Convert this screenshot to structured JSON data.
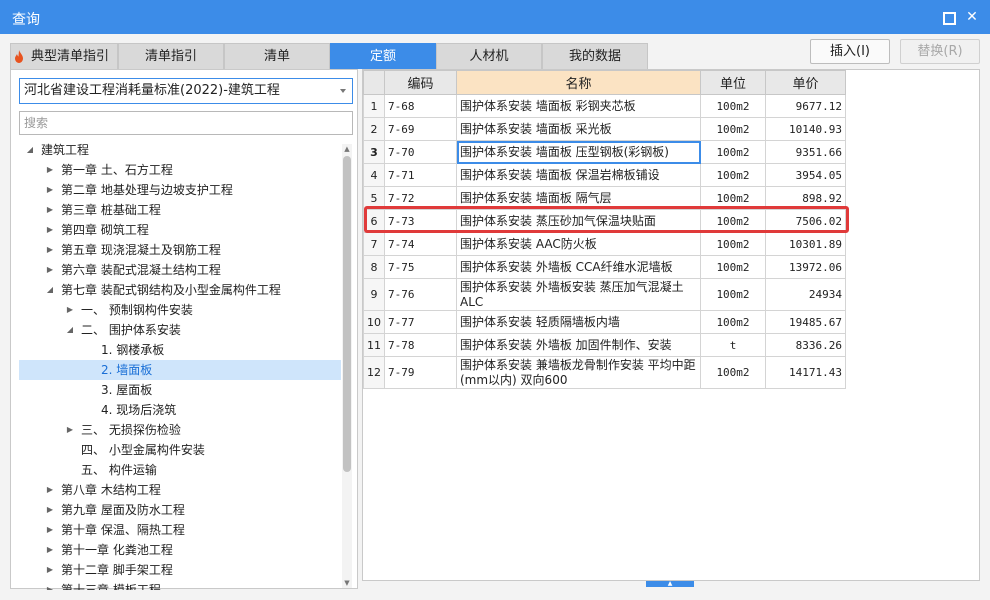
{
  "window": {
    "title": "查询",
    "maximize_glyph": "",
    "close_glyph": "✕"
  },
  "tabs": [
    {
      "label": "典型清单指引",
      "icon": "flame-icon"
    },
    {
      "label": "清单指引"
    },
    {
      "label": "清单"
    },
    {
      "label": "定额",
      "active": true
    },
    {
      "label": "人材机"
    },
    {
      "label": "我的数据"
    }
  ],
  "actions": {
    "insert_label": "插入(I)",
    "replace_label": "替换(R)"
  },
  "left": {
    "standard_selected": "河北省建设工程消耗量标准(2022)-建筑工程",
    "search_placeholder": "搜索",
    "tree": [
      {
        "label": "建筑工程",
        "state": "open",
        "level": 0
      },
      {
        "label": "第一章 土、石方工程",
        "state": "closed",
        "level": 1
      },
      {
        "label": "第二章 地基处理与边坡支护工程",
        "state": "closed",
        "level": 1
      },
      {
        "label": "第三章 桩基础工程",
        "state": "closed",
        "level": 1
      },
      {
        "label": "第四章 砌筑工程",
        "state": "closed",
        "level": 1
      },
      {
        "label": "第五章 现浇混凝土及钢筋工程",
        "state": "closed",
        "level": 1
      },
      {
        "label": "第六章 装配式混凝土结构工程",
        "state": "closed",
        "level": 1
      },
      {
        "label": "第七章 装配式钢结构及小型金属构件工程",
        "state": "open",
        "level": 1
      },
      {
        "label": "一、 预制钢构件安装",
        "state": "closed",
        "level": 2
      },
      {
        "label": "二、 围护体系安装",
        "state": "open",
        "level": 2
      },
      {
        "label": "1. 钢楼承板",
        "state": "leaf",
        "level": 3
      },
      {
        "label": "2. 墙面板",
        "state": "leaf",
        "level": 3,
        "selected": true
      },
      {
        "label": "3. 屋面板",
        "state": "leaf",
        "level": 3
      },
      {
        "label": "4. 现场后浇筑",
        "state": "leaf",
        "level": 3
      },
      {
        "label": "三、 无损探伤检验",
        "state": "closed",
        "level": 2
      },
      {
        "label": "四、 小型金属构件安装",
        "state": "leaf",
        "level": 2
      },
      {
        "label": "五、 构件运输",
        "state": "leaf",
        "level": 2
      },
      {
        "label": "第八章 木结构工程",
        "state": "closed",
        "level": 1
      },
      {
        "label": "第九章 屋面及防水工程",
        "state": "closed",
        "level": 1
      },
      {
        "label": "第十章 保温、隔热工程",
        "state": "closed",
        "level": 1
      },
      {
        "label": "第十一章 化粪池工程",
        "state": "closed",
        "level": 1
      },
      {
        "label": "第十二章 脚手架工程",
        "state": "closed",
        "level": 1
      },
      {
        "label": "第十三章 模板工程",
        "state": "closed",
        "level": 1
      }
    ]
  },
  "table": {
    "headers": {
      "code": "编码",
      "name": "名称",
      "unit": "单位",
      "price": "单价"
    },
    "rows": [
      {
        "idx": "1",
        "code": "7-68",
        "name": "围护体系安装 墙面板 彩钢夹芯板",
        "unit": "100m2",
        "price": "9677.12"
      },
      {
        "idx": "2",
        "code": "7-69",
        "name": "围护体系安装 墙面板 采光板",
        "unit": "100m2",
        "price": "10140.93"
      },
      {
        "idx": "3",
        "code": "7-70",
        "name": "围护体系安装 墙面板 压型钢板(彩钢板)",
        "unit": "100m2",
        "price": "9351.66",
        "selected": true
      },
      {
        "idx": "4",
        "code": "7-71",
        "name": "围护体系安装 墙面板 保温岩棉板铺设",
        "unit": "100m2",
        "price": "3954.05"
      },
      {
        "idx": "5",
        "code": "7-72",
        "name": "围护体系安装 墙面板 隔气层",
        "unit": "100m2",
        "price": "898.92"
      },
      {
        "idx": "6",
        "code": "7-73",
        "name": "围护体系安装 蒸压砂加气保温块贴面",
        "unit": "100m2",
        "price": "7506.02"
      },
      {
        "idx": "7",
        "code": "7-74",
        "name": "围护体系安装 AAC防火板",
        "unit": "100m2",
        "price": "10301.89"
      },
      {
        "idx": "8",
        "code": "7-75",
        "name": "围护体系安装 外墙板 CCA纤维水泥墙板",
        "unit": "100m2",
        "price": "13972.06"
      },
      {
        "idx": "9",
        "code": "7-76",
        "name": "围护体系安装 外墙板安装 蒸压加气混凝土ALC",
        "unit": "100m2",
        "price": "24934",
        "tall": true
      },
      {
        "idx": "10",
        "code": "7-77",
        "name": "围护体系安装 轻质隔墙板内墙",
        "unit": "100m2",
        "price": "19485.67"
      },
      {
        "idx": "11",
        "code": "7-78",
        "name": "围护体系安装 外墙板 加固件制作、安装",
        "unit": "t",
        "price": "8336.26"
      },
      {
        "idx": "12",
        "code": "7-79",
        "name": "围护体系安装 兼墙板龙骨制作安装 平均中距(mm以内) 双向600",
        "unit": "100m2",
        "price": "14171.43",
        "tall": true
      }
    ]
  },
  "colors": {
    "accent": "#3c8ce8",
    "highlight_border": "#e03a3a",
    "header_highlight": "#fbe3c3",
    "selected_row": "#cfe5fb"
  }
}
